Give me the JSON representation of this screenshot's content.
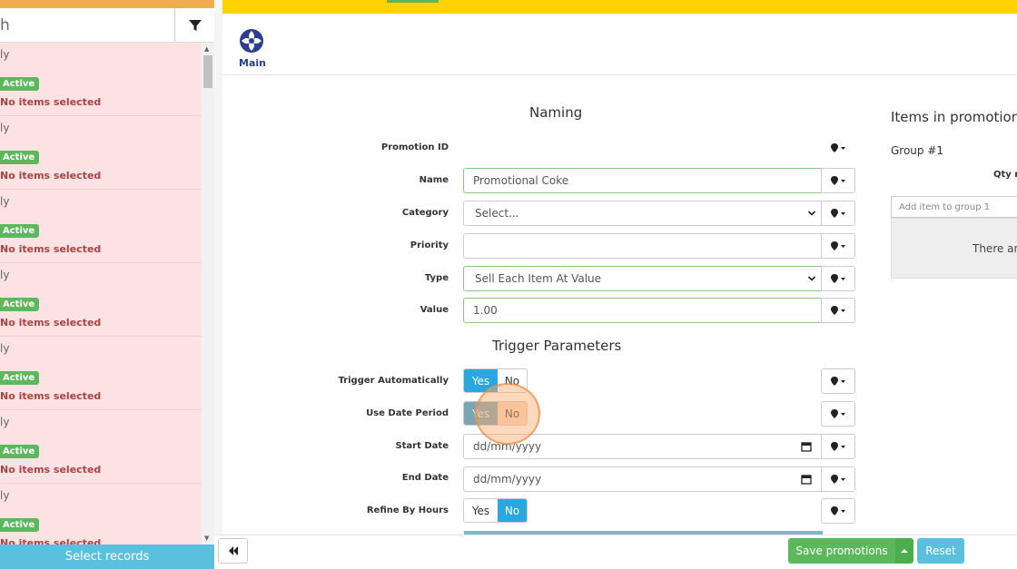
{
  "sidebar": {
    "search_value": "h",
    "items": [
      {
        "top": "ly",
        "badge": "Active",
        "sub": "No items selected"
      },
      {
        "top": "ly",
        "badge": "Active",
        "sub": "No items selected"
      },
      {
        "top": "ly",
        "badge": "Active",
        "sub": "No items selected"
      },
      {
        "top": "ly",
        "badge": "Active",
        "sub": "No items selected"
      },
      {
        "top": "ly",
        "badge": "Active",
        "sub": "No items selected"
      },
      {
        "top": "ly",
        "badge": "Active",
        "sub": "No items selected"
      },
      {
        "top": "ly",
        "badge": "Active",
        "sub": "No items selected"
      }
    ],
    "select_records_label": "Select records"
  },
  "header": {
    "main_label": "Main"
  },
  "naming": {
    "title": "Naming",
    "promotion_id_label": "Promotion ID",
    "name_label": "Name",
    "name_value": "Promotional Coke",
    "category_label": "Category",
    "category_value": "Select...",
    "priority_label": "Priority",
    "priority_value": "",
    "type_label": "Type",
    "type_value": "Sell Each Item At Value",
    "value_label": "Value",
    "value_value": "1.00"
  },
  "trigger": {
    "title": "Trigger Parameters",
    "trigger_auto_label": "Trigger Automatically",
    "use_date_label": "Use Date Period",
    "start_date_label": "Start Date",
    "end_date_label": "End Date",
    "date_placeholder": "dd/mm/yyyy",
    "refine_hours_label": "Refine By Hours",
    "yes": "Yes",
    "no": "No"
  },
  "items_panel": {
    "title": "Items in promotion",
    "group_label": "Group #1",
    "qty_label": "Qty r",
    "add_item_placeholder": "Add item to group 1",
    "empty_text": "There are"
  },
  "footer": {
    "save_label": "Save promotions",
    "reset_label": "Reset"
  },
  "colors": {
    "accent_blue": "#29a8e0",
    "green": "#5cb85c",
    "yellow": "#ffd200",
    "list_bg": "#fde2e3"
  }
}
